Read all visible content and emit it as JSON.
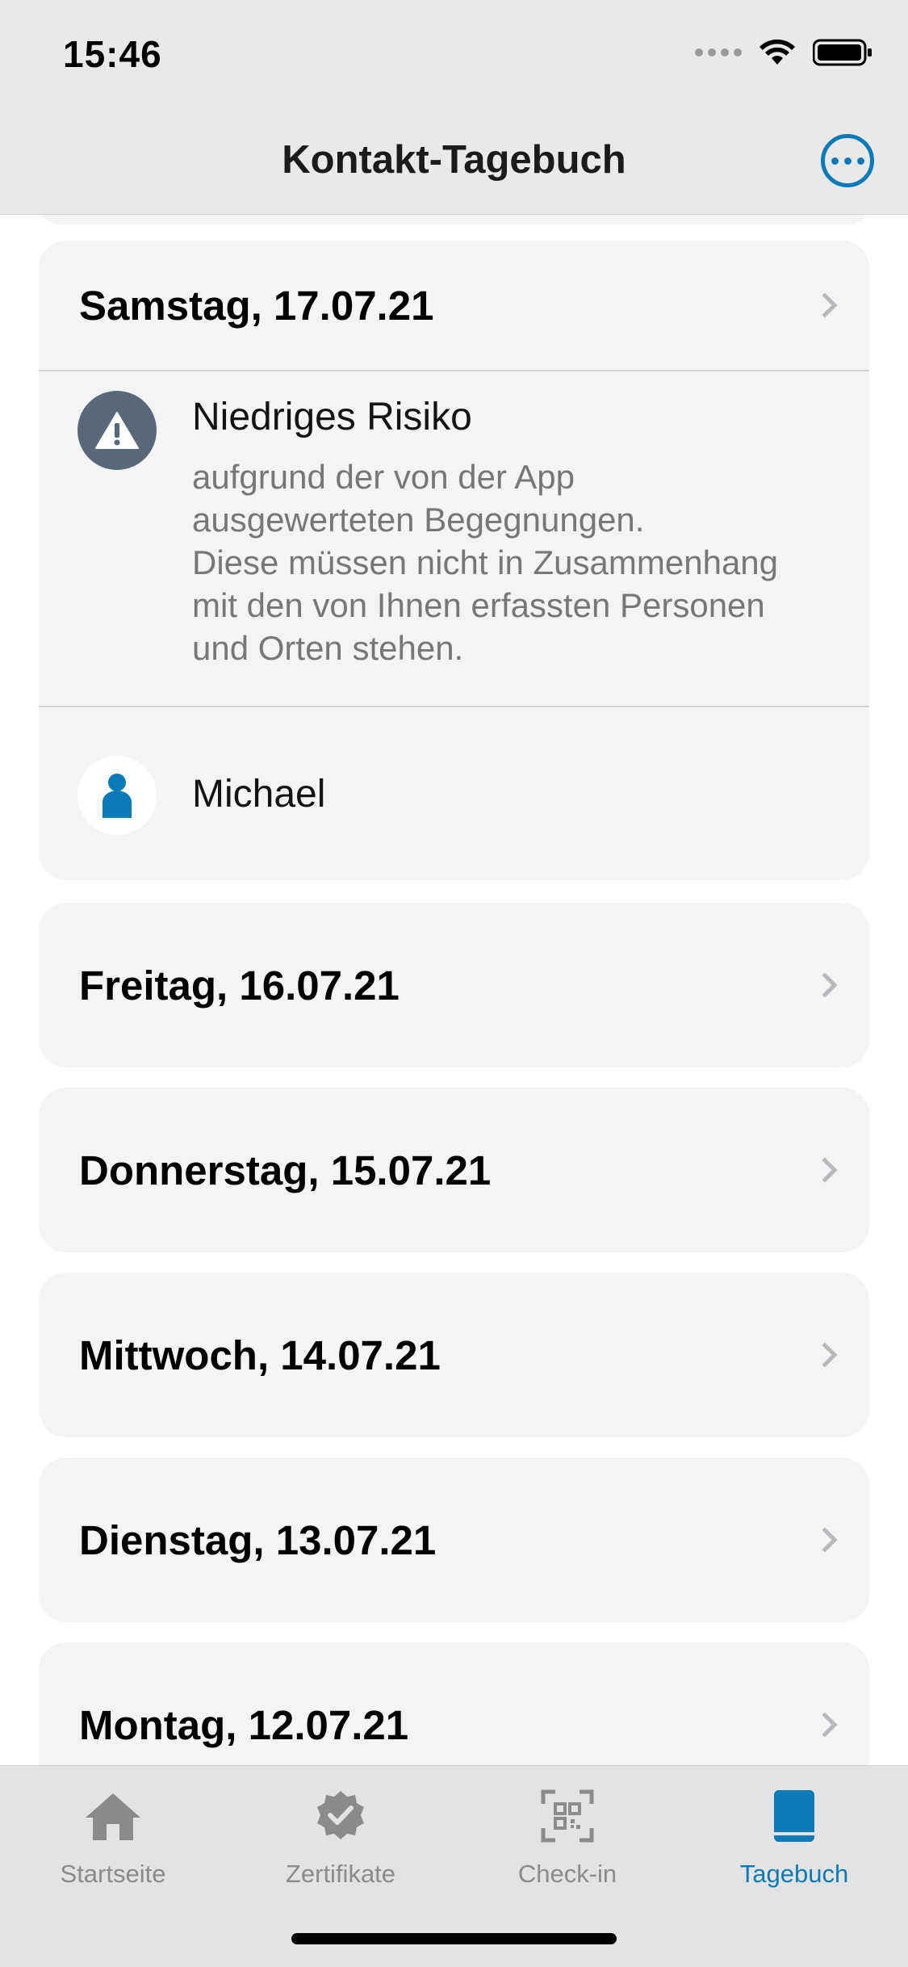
{
  "status_bar": {
    "time": "15:46"
  },
  "nav": {
    "title": "Kontakt-Tagebuch"
  },
  "days": [
    {
      "label": "Samstag, 17.07.21"
    },
    {
      "label": "Freitag, 16.07.21"
    },
    {
      "label": "Donnerstag, 15.07.21"
    },
    {
      "label": "Mittwoch, 14.07.21"
    },
    {
      "label": "Dienstag, 13.07.21"
    },
    {
      "label": "Montag, 12.07.21"
    }
  ],
  "risk": {
    "title": "Niedriges Risiko",
    "lines": [
      "aufgrund der von der App",
      "ausgewerteten Begegnungen.",
      "Diese müssen nicht in Zusammenhang",
      "mit den von Ihnen erfassten Personen",
      "und Orten stehen."
    ]
  },
  "person": {
    "name": "Michael"
  },
  "tabs": [
    {
      "label": "Startseite",
      "icon": "home-icon"
    },
    {
      "label": "Zertifikate",
      "icon": "certificate-icon"
    },
    {
      "label": "Check-in",
      "icon": "qr-scan-icon"
    },
    {
      "label": "Tagebuch",
      "icon": "book-icon",
      "active": true
    }
  ],
  "colors": {
    "accent": "#0a7bb6",
    "risk_icon_bg": "#58677a",
    "card_bg": "#f4f4f4"
  }
}
